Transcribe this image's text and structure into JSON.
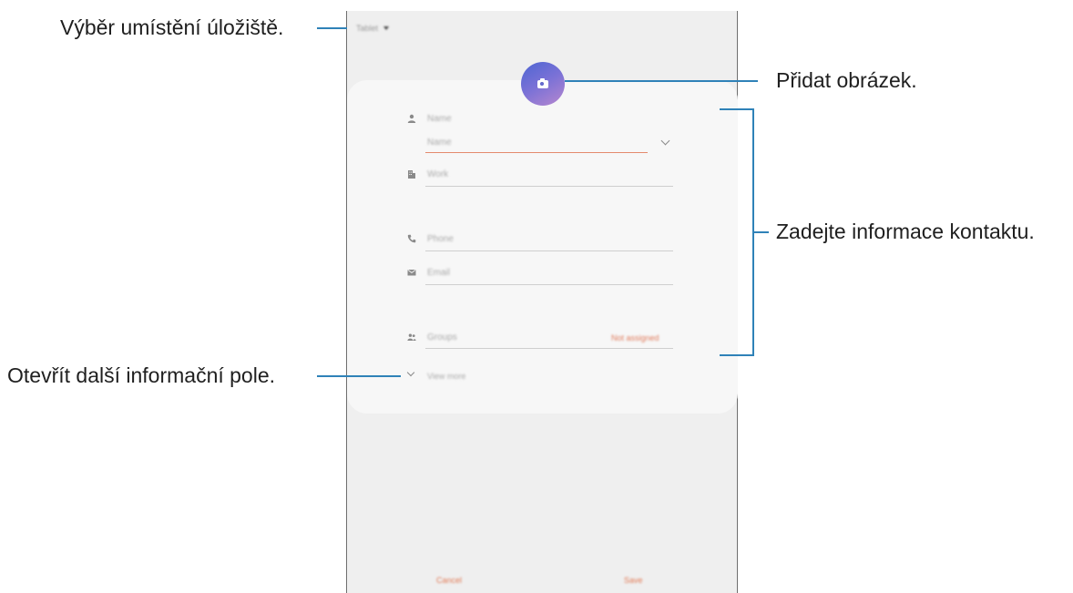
{
  "callouts": {
    "storage": "Výběr umístění úložiště.",
    "picture": "Přidat obrázek.",
    "contact_info": "Zadejte informace kontaktu.",
    "more_fields": "Otevřít další informační pole."
  },
  "screen": {
    "storage_label": "Tablet",
    "fields": {
      "name_header": "Name",
      "name_input": "Name",
      "work": "Work",
      "phone": "Phone",
      "email": "Email",
      "groups": "Groups",
      "groups_value": "Not assigned",
      "view_more": "View more"
    },
    "buttons": {
      "cancel": "Cancel",
      "save": "Save"
    },
    "icons": {
      "avatar": "camera-icon",
      "name": "person-icon",
      "work": "building-icon",
      "phone": "phone-icon",
      "email": "envelope-icon",
      "groups": "people-icon",
      "expand": "chevron-down-icon"
    },
    "colors": {
      "accent": "#e27a55",
      "avatar_start": "#4d65d3",
      "avatar_end": "#b787cf",
      "callout_line": "#2f82b8"
    }
  }
}
